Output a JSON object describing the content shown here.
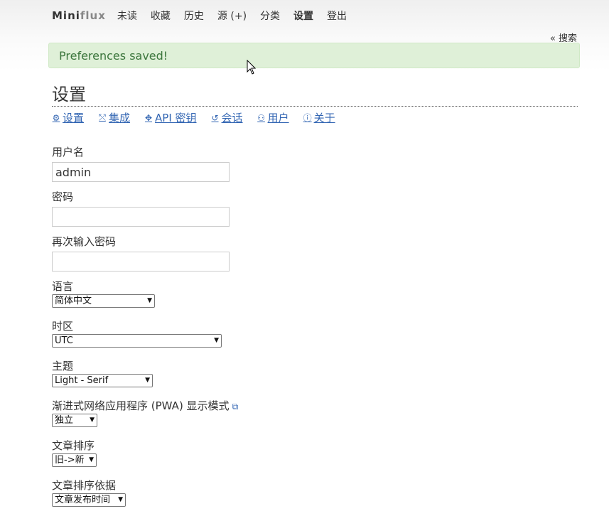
{
  "header": {
    "logo_prefix": "Mini",
    "logo_suffix": "flux",
    "nav": [
      "未读",
      "收藏",
      "历史",
      "源 (+)",
      "分类",
      "设置",
      "登出"
    ],
    "search_link": "« 搜索"
  },
  "flash": {
    "message": "Preferences saved!"
  },
  "page": {
    "title": "设置",
    "tabs": [
      "设置",
      "集成",
      "API 密钥",
      "会话",
      "用户",
      "关于"
    ]
  },
  "form": {
    "username_label": "用户名",
    "username_value": "admin",
    "password_label": "密码",
    "password_value": "",
    "confirm_label": "再次输入密码",
    "confirm_value": "",
    "language_label": "语言",
    "language_value": "简体中文",
    "timezone_label": "时区",
    "timezone_value": "UTC",
    "theme_label": "主题",
    "theme_value": "Light - Serif",
    "pwa_label": "渐进式网络应用程序 (PWA) 显示模式",
    "pwa_value": "独立",
    "order_label": "文章排序",
    "order_value": "旧->新",
    "order_by_label": "文章排序依据",
    "order_by_value": "文章发布时间"
  }
}
